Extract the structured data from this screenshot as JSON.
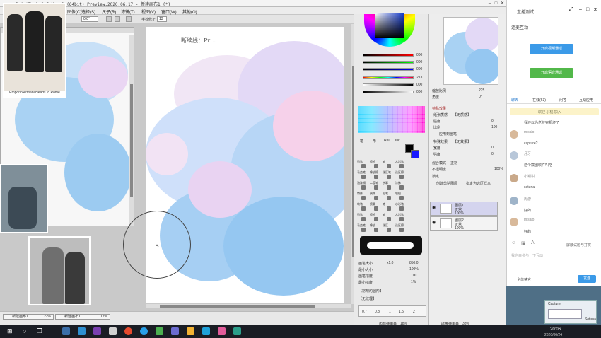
{
  "titlebar": {
    "title": "PaintTool SAI Ver.2 (64bit) Preview.2020.06.17 - 新建画布1 (*)"
  },
  "menu": {
    "items": [
      "图像(C)",
      "选择(S)",
      "尺子(R)",
      "滤镜(T)",
      "视图(V)",
      "窗口(W)",
      "其他(O)"
    ]
  },
  "toolbar": {
    "angle": "0.0°",
    "stabilizer_label": "手抖修正",
    "stabilizer_value": "13"
  },
  "canvas": {
    "handwritten_note": "断续线：Pr…"
  },
  "overlay_photos": {
    "top_caption": "Emporio Armani Heads to Rome"
  },
  "colors": {
    "cloud_blue": "#8fc4ef",
    "cloud_pink": "#f3c8e8",
    "cloud_lavender": "#d9ccf4",
    "primary": "#000000",
    "secondary": "#ffffff"
  },
  "color_sliders": {
    "values": [
      "000",
      "000",
      "000",
      "213",
      "000",
      "000"
    ]
  },
  "brush_panel": {
    "section_label": "特殊效果",
    "texture_label": "纸张质感",
    "texture_value": "【无质感】",
    "strength_label": "强度",
    "strength_value": "0",
    "scale_label": "比例",
    "scale_value": "100",
    "apply_label": "应用到画笔",
    "effect_label": "特殊效果",
    "effect_value": "【无效果】",
    "width_label": "宽度",
    "width_value": "0",
    "effect_strength_label": "强度",
    "effect_strength_value": "0",
    "blend_label": "混合模式",
    "blend_value": "正常",
    "opacity_label": "不透明度",
    "opacity_value": "100%",
    "lock_label": "锁定",
    "clip_label": "创建剪贴图层",
    "select_source_label": "指定为选区样本"
  },
  "layers": [
    {
      "name": "图层1",
      "mode": "正常",
      "opacity": "100%"
    },
    {
      "name": "图层2",
      "mode": "正常",
      "opacity": "100%"
    }
  ],
  "navigator": {
    "zoom_label": "缩放比例",
    "zoom_value": "225",
    "angle_label": "角度",
    "angle_value": "0°"
  },
  "brush_settings": {
    "size_label": "画笔大小",
    "size_mult": "x1.0",
    "size_value": "850.0",
    "min_size_label": "最小大小",
    "min_size_value": "100%",
    "density_label": "画笔浓度",
    "density_value": "100",
    "min_density_label": "最小浓度",
    "min_density_value": "1%",
    "shape_label": "【常规的圆形】",
    "texture_label": "【无纹理】",
    "size_presets": [
      "0.7",
      "0.8",
      "1",
      "1.5",
      "2"
    ]
  },
  "tool_groups": {
    "tabs": [
      "笔",
      "形",
      "ReL",
      "Ink"
    ],
    "rows": [
      [
        "铅笔",
        "喷枪",
        "笔",
        "水彩笔"
      ],
      [
        "马克笔",
        "橡皮擦",
        "选区笔",
        "选区擦"
      ],
      [
        "油漆桶",
        "二值笔",
        "水彩",
        "涂抹"
      ],
      [
        "特殊",
        "模糊",
        "铅笔",
        "喷枪"
      ],
      [
        "软笔",
        "喷雾",
        "笔",
        "水彩笔"
      ],
      [
        "铅笔",
        "喷枪",
        "笔",
        "水彩笔"
      ],
      [
        "马克笔",
        "橡皮",
        "选区",
        "选区擦"
      ]
    ]
  },
  "statusbar": {
    "memory_label": "内存使用量",
    "memory_value": "18%",
    "disk_label": "磁盘使用量",
    "disk_value": "38%",
    "tabs": [
      {
        "name": "新建画布1",
        "zoom": "22%"
      },
      {
        "name": "新建画布1",
        "zoom": "17%"
      }
    ]
  },
  "chat": {
    "window_title": "直播测试",
    "section_title": "连麦互动",
    "video_button": "开启视频通话",
    "voice_button": "开启语音通话",
    "tabs": [
      "聊天",
      "在线(63)",
      "问答",
      "互动应用"
    ],
    "welcome": "欢迎 小桃 加入",
    "messages": [
      {
        "name": "",
        "text": "我还以为老拉完机坏了"
      },
      {
        "name": "misalo",
        "text": "capture?"
      },
      {
        "name": "月牙",
        "text": "这个截图软件叫啥"
      },
      {
        "name": "小钳钳",
        "text": "setuna"
      },
      {
        "name": "周游",
        "text": "好的"
      },
      {
        "name": "misalo",
        "text": "好的"
      }
    ],
    "only_teacher": "屏蔽试题与打赏",
    "input_placeholder": "我也来参与一下互动",
    "mute_label": "全体禁言",
    "send_button": "发送"
  },
  "mini_window": {
    "title": "Capture",
    "label": "Setuna"
  },
  "clock": {
    "time": "20:06",
    "date": "2020/06/24"
  }
}
